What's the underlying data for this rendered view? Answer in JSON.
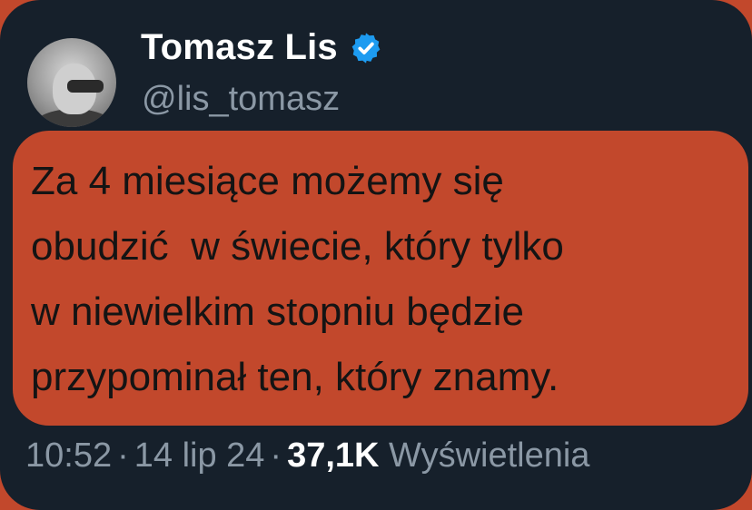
{
  "author": {
    "name": "Tomasz Lis",
    "handle": "@lis_tomasz",
    "verified_icon": "verified-badge-icon",
    "verified_color": "#1d9bf0"
  },
  "tweet": {
    "text": "Za 4 miesiące możemy się\nobudzić  w świecie, który tylko\nw niewielkim stopniu będzie\nprzypominał ten, który znamy."
  },
  "meta": {
    "time": "10:52",
    "separator": "·",
    "date": "14 lip 24",
    "views_count": "37,1K",
    "views_label": "Wyświetlenia"
  },
  "colors": {
    "card_background": "#16202b",
    "highlight": "#c2482c",
    "secondary_text": "#8b98a5"
  }
}
